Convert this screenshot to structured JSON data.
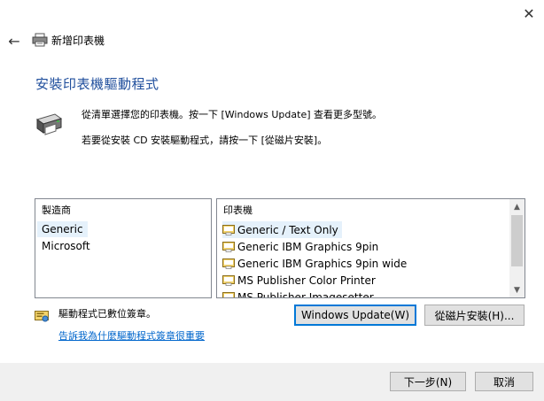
{
  "window": {
    "close_label": "✕"
  },
  "header": {
    "back_label": "←",
    "title": "新增印表機"
  },
  "main": {
    "heading": "安裝印表機驅動程式",
    "instruction_1": "從清單選擇您的印表機。按一下 [Windows Update] 查看更多型號。",
    "instruction_2": "若要從安裝 CD 安裝驅動程式，請按一下 [從磁片安裝]。"
  },
  "manufacturer_list": {
    "header": "製造商",
    "items": [
      "Generic",
      "Microsoft"
    ],
    "selected_index": 0
  },
  "printer_list": {
    "header": "印表機",
    "items": [
      "Generic / Text Only",
      "Generic IBM Graphics 9pin",
      "Generic IBM Graphics 9pin wide",
      "MS Publisher Color Printer",
      "MS Publisher Imagesetter"
    ],
    "selected_index": 0
  },
  "signature": {
    "status_text": "驅動程式已數位簽章。",
    "link_text": "告訴我為什麼驅動程式簽章很重要"
  },
  "buttons": {
    "windows_update": "Windows Update(W)",
    "have_disk": "從磁片安裝(H)...",
    "next": "下一步(N)",
    "cancel": "取消"
  },
  "icons": {
    "back": "back-arrow-icon",
    "printer": "printer-icon",
    "driver_signed": "certificate-icon"
  },
  "colors": {
    "heading": "#1f4e9c",
    "link": "#0066cc",
    "selection": "#e5f1fb",
    "focus_border": "#0078d7",
    "footer_bg": "#f0f0f0"
  }
}
